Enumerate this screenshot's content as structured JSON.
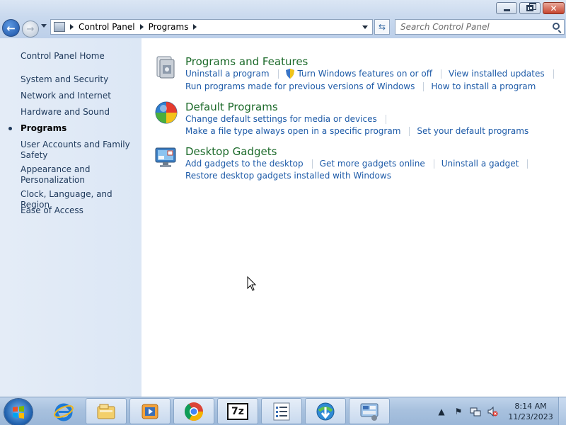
{
  "window": {
    "controls": {
      "minimize_icon": "minimize-icon",
      "maximize_icon": "restore-icon",
      "close_icon": "close-icon"
    }
  },
  "nav": {
    "back_icon": "back-arrow-icon",
    "forward_icon": "forward-arrow-icon",
    "breadcrumb": [
      "Control Panel",
      "Programs"
    ],
    "search_placeholder": "Search Control Panel"
  },
  "sidebar": {
    "home": "Control Panel Home",
    "items": [
      {
        "label": "System and Security"
      },
      {
        "label": "Network and Internet"
      },
      {
        "label": "Hardware and Sound"
      },
      {
        "label": "Programs",
        "current": true
      },
      {
        "label": "User Accounts and Family Safety"
      },
      {
        "label": "Appearance and Personalization"
      },
      {
        "label": "Clock, Language, and Region"
      },
      {
        "label": "Ease of Access"
      }
    ]
  },
  "categories": [
    {
      "title": "Programs and Features",
      "icon": "programs-features-icon",
      "rows": [
        [
          "Uninstall a program",
          "Turn Windows features on or off",
          "View installed updates"
        ],
        [
          "Run programs made for previous versions of Windows",
          "How to install a program"
        ]
      ]
    },
    {
      "title": "Default Programs",
      "icon": "default-programs-icon",
      "rows": [
        [
          "Change default settings for media or devices"
        ],
        [
          "Make a file type always open in a specific program",
          "Set your default programs"
        ]
      ]
    },
    {
      "title": "Desktop Gadgets",
      "icon": "desktop-gadgets-icon",
      "rows": [
        [
          "Add gadgets to the desktop",
          "Get more gadgets online",
          "Uninstall a gadget"
        ],
        [
          "Restore desktop gadgets installed with Windows"
        ]
      ]
    }
  ],
  "taskbar": {
    "start_icon": "windows-start-icon",
    "apps": [
      {
        "name": "internet-explorer-icon"
      },
      {
        "name": "file-explorer-icon"
      },
      {
        "name": "media-player-icon"
      },
      {
        "name": "chrome-icon"
      },
      {
        "name": "7zip-icon",
        "label": "7z"
      },
      {
        "name": "list-app-icon"
      },
      {
        "name": "download-manager-icon"
      },
      {
        "name": "control-panel-icon"
      }
    ],
    "tray_icons": [
      "show-hidden-icons",
      "action-center-icon",
      "network-icon",
      "volume-muted-icon"
    ],
    "time": "8:14 AM",
    "date": "11/23/2023"
  }
}
